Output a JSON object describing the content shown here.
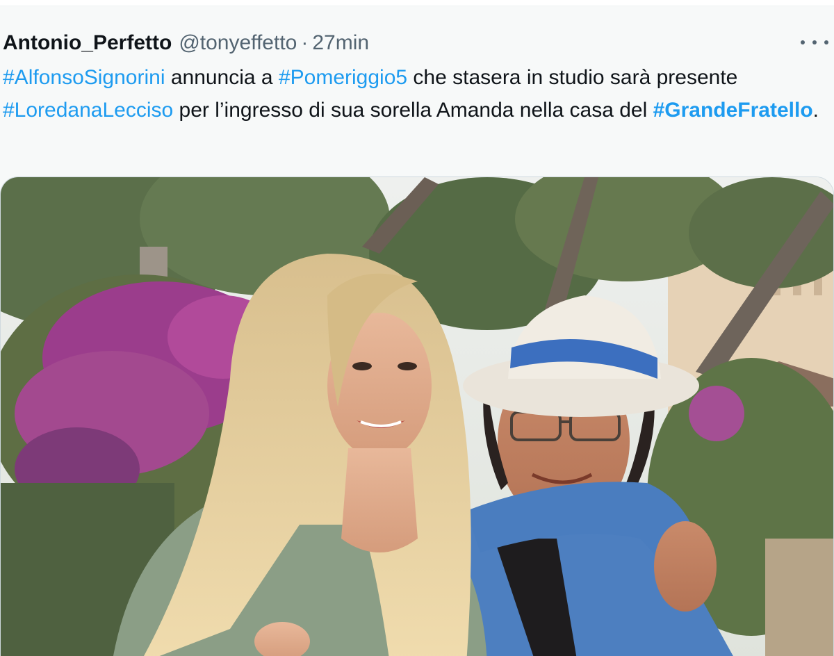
{
  "tweet": {
    "display_name": "Antonio_Perfetto",
    "handle": "@tonyeffetto",
    "separator": "·",
    "time": "27min",
    "more_icon": "more-horizontal-icon",
    "text": {
      "hashtag1": "#AlfonsoSignorini",
      "part1": " annuncia a ",
      "hashtag2": "#Pomeriggio5",
      "part2": " che stasera in studio sarà presente ",
      "hashtag3": "#LoredanaLecciso",
      "part3": " per l’ingresso di sua sorella Amanda nella casa del ",
      "hashtag4": "#GrandeFratello",
      "part4": "."
    },
    "colors": {
      "link": "#1d9bf0",
      "text": "#0f1419",
      "secondary": "#536471",
      "background": "#f7f9f9"
    }
  }
}
